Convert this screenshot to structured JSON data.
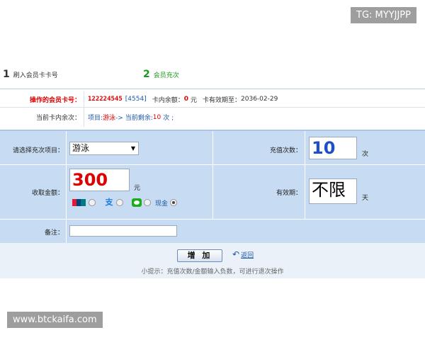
{
  "watermarks": {
    "top": "TG: MYYJJPP",
    "bottom": "www.btckaifa.com"
  },
  "steps": [
    {
      "num": "1",
      "label": "刷入会员卡卡号"
    },
    {
      "num": "2",
      "label": "会员充次"
    }
  ],
  "card_info": {
    "card_label": "操作的会员卡号：",
    "card_number": "122224545",
    "card_code": "[4554]",
    "balance_label": "卡内余额：",
    "balance_value": "0",
    "balance_unit": "元",
    "expiry_label": "卡有效期至：",
    "expiry_value": "2036-02-29",
    "times_label": "当前卡内余次：",
    "times_item_prefix": "项目:",
    "times_item": "游泳",
    "times_arrow": " -> 当前剩余:",
    "times_count": "10",
    "times_unit": "次 ;"
  },
  "form": {
    "project_label": "请选择充次项目：",
    "project_value": "游泳",
    "recharge_times_label": "充值次数：",
    "recharge_times_value": "10",
    "recharge_times_unit": "次",
    "amount_label": "收取金额：",
    "amount_value": "300",
    "amount_unit": "元",
    "payment": {
      "cash_label": "现金",
      "selected": "现金"
    },
    "validity_label": "有效期：",
    "validity_value": "不限",
    "validity_unit": "天",
    "notes_label": "备注：",
    "notes_value": ""
  },
  "actions": {
    "add_label": "增 加",
    "back_label": "返回"
  },
  "tip": "小提示：充值次数/金额输入负数，可进行退次操作"
}
